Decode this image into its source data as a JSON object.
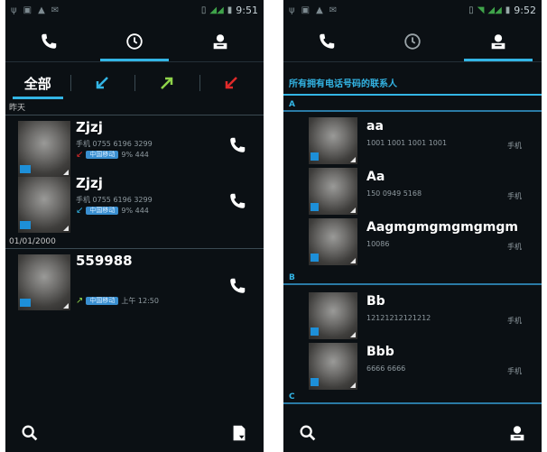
{
  "left": {
    "status": {
      "time": "9:51"
    },
    "filters": [
      {
        "label": "全部",
        "icon": ""
      },
      {
        "label": "",
        "icon": "incoming-arrow-icon",
        "color": "#33b5e5"
      },
      {
        "label": "",
        "icon": "outgoing-arrow-icon",
        "color": "#8fd44a"
      },
      {
        "label": "",
        "icon": "missed-arrow-icon",
        "color": "#e02a2a"
      }
    ],
    "sections": [
      {
        "header": "昨天"
      },
      {
        "header": "01/01/2000"
      }
    ],
    "calls": [
      {
        "name": "Zjzj",
        "detail": "手机 0755 6196 3299",
        "pill": "中国移动",
        "time": "9% 444",
        "arrow": "↙",
        "arrow_color": "#e02a2a"
      },
      {
        "name": "Zjzj",
        "detail": "手机 0755 6196 3299",
        "pill": "中国移动",
        "time": "9% 444",
        "arrow": "↙",
        "arrow_color": "#33b5e5"
      },
      {
        "name": "559988",
        "detail": "",
        "pill": "中国移动",
        "time": "上午 12:50",
        "arrow": "↗",
        "arrow_color": "#8fd44a"
      }
    ]
  },
  "right": {
    "status": {
      "time": "9:52"
    },
    "header": "所有拥有电话号码的联系人",
    "letters": [
      "A",
      "B",
      "C"
    ],
    "contacts": [
      {
        "name": "aa",
        "number": "1001 1001 1001 1001",
        "type": "手机"
      },
      {
        "name": "Aa",
        "number": "150 0949 5168",
        "type": "手机"
      },
      {
        "name": "Aagmgmgmgmgmgm",
        "number": "10086",
        "type": "手机"
      },
      {
        "name": "Bb",
        "number": "12121212121212",
        "type": "手机"
      },
      {
        "name": "Bbb",
        "number": "6666 6666",
        "type": "手机"
      }
    ]
  }
}
